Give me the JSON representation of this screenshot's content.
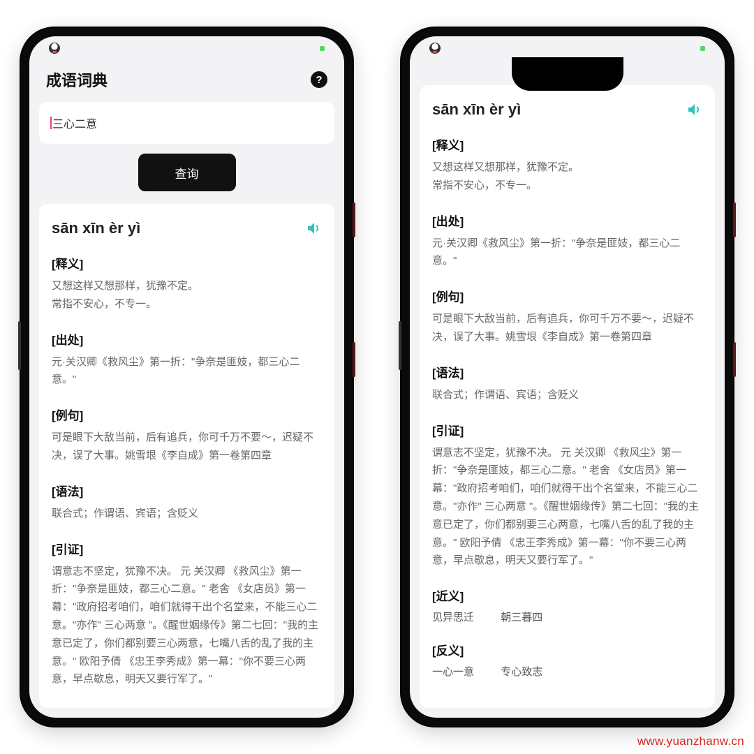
{
  "app": {
    "title": "成语词典"
  },
  "search": {
    "value": "三心二意",
    "button": "查询"
  },
  "entry": {
    "pinyin": "sān xīn èr yì",
    "sections": {
      "shiyi_title": "[释义]",
      "shiyi_body": "又想这样又想那样，犹豫不定。\n常指不安心，不专一。",
      "chuchu_title": "[出处]",
      "chuchu_body": " 元·关汉卿《救风尘》第一折：\"争奈是匪妓，都三心二意。\"",
      "liju_title": "[例句]",
      "liju_body": " 可是眼下大敌当前，后有追兵，你可千万不要～，迟疑不决，误了大事。姚雪垠《李自成》第一卷第四章",
      "yufa_title": "[语法]",
      "yufa_body": " 联合式；作谓语、宾语；含贬义",
      "yinzheng_title": "[引证]",
      "yinzheng_body": "谓意志不坚定，犹豫不决。 元 关汉卿 《救风尘》第一折：\"争奈是匪妓，都三心二意。\" 老舍 《女店员》第一幕：\"政府招考咱们，咱们就得干出个名堂来，不能三心二意。\"亦作\" 三心两意 \"。《醒世姻缘传》第二七回：\"我的主意已定了，你们都别要三心两意，七嘴八舌的乱了我的主意。\" 欧阳予倩 《忠王李秀成》第一幕：\"你不要三心两意，早点歇息，明天又要行军了。\"",
      "jinyi_title": "[近义]",
      "jinyi_items": [
        "见异思迁",
        "朝三暮四"
      ],
      "fanyi_title": "[反义]",
      "fanyi_items": [
        "一心一意",
        "专心致志"
      ]
    }
  },
  "watermark": "www.yuanzhanw.cn"
}
